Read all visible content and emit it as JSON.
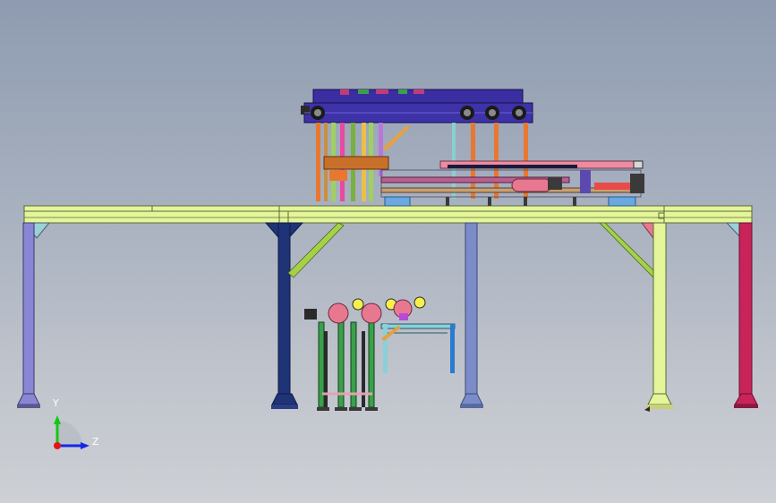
{
  "view": {
    "background_top": "#8e9bb0",
    "background_bottom": "#cdd0d5"
  },
  "triad": {
    "y_label": "Y",
    "z_label": "Z",
    "y_color": "#14c814",
    "z_color": "#1428e6",
    "x_color": "#e61414"
  },
  "colors": {
    "frame_yellow": "#e4f59a",
    "frame_edge": "#5a6a3a",
    "leg_lavender": "#8a86d6",
    "leg_navy": "#1f3377",
    "leg_steel": "#7b8cc8",
    "leg_crimson": "#c8245a",
    "brace_green": "#a6d04a",
    "conveyor_blue": "#3a2ea0",
    "orange": "#e87830",
    "pink": "#e87890"
  }
}
